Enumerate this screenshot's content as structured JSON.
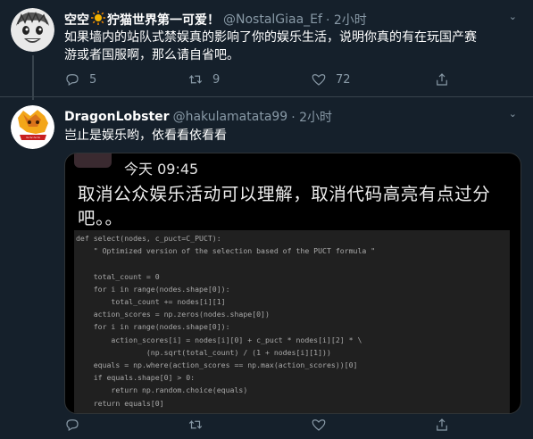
{
  "tweets": [
    {
      "name": "空空",
      "name_suffix": "狞猫世界第一可爱！",
      "handle": "@NostalGiaa_Ef",
      "time": "· 2小时",
      "text_line1": "如果墙内的站队式禁娱真的影响了你的娱乐生活，说明你真的有在玩国产赛",
      "text_line2": "游或者国服啊，那么请自省吧。",
      "actions": {
        "reply": "5",
        "retweet": "9",
        "like": "72"
      }
    },
    {
      "name": "DragonLobster",
      "handle": "@hakulamatata99",
      "time": "· 2小时",
      "text": "岂止是娱乐哟，依看看依看看",
      "media": {
        "time": "今天 09:45",
        "headline": "取消公众娱乐活动可以理解，取消代码高亮有点过分吧。。",
        "code": [
          "def select(nodes, c_puct=C_PUCT):",
          "    \" Optimized version of the selection based of the PUCT formula \"",
          "",
          "    total_count = 0",
          "    for i in range(nodes.shape[0]):",
          "        total_count += nodes[i][1]",
          "    action_scores = np.zeros(nodes.shape[0])",
          "    for i in range(nodes.shape[0]):",
          "        action_scores[i] = nodes[i][0] + c_puct * nodes[i][2] * \\",
          "                (np.sqrt(total_count) / (1 + nodes[i][1]))",
          "    equals = np.where(action_scores == np.max(action_scores))[0]",
          "    if equals.shape[0] > 0:",
          "        return np.random.choice(equals)",
          "    return equals[0]"
        ]
      }
    }
  ],
  "colors": {
    "background": "#15202b",
    "secondary_text": "#8899a6",
    "line": "#38444d"
  }
}
